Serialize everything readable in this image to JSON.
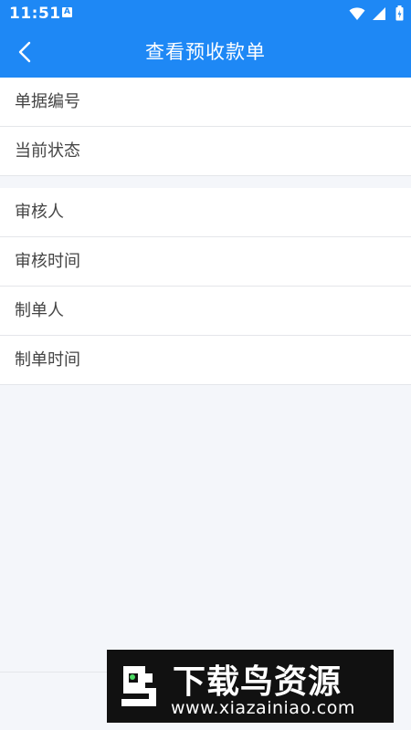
{
  "status_bar": {
    "time": "11:51",
    "notification_letter": "A"
  },
  "header": {
    "title": "查看预收款单"
  },
  "section1": {
    "rows": [
      {
        "label": "单据编号"
      },
      {
        "label": "当前状态"
      }
    ]
  },
  "section2": {
    "rows": [
      {
        "label": "审核人"
      },
      {
        "label": "审核时间"
      },
      {
        "label": "制单人"
      },
      {
        "label": "制单时间"
      }
    ]
  },
  "watermark": {
    "title": "下载鸟资源",
    "url": "www.xiazainiao.com"
  },
  "colors": {
    "primary": "#1e88f5",
    "background": "#f4f6fa",
    "row_text": "#444444"
  }
}
